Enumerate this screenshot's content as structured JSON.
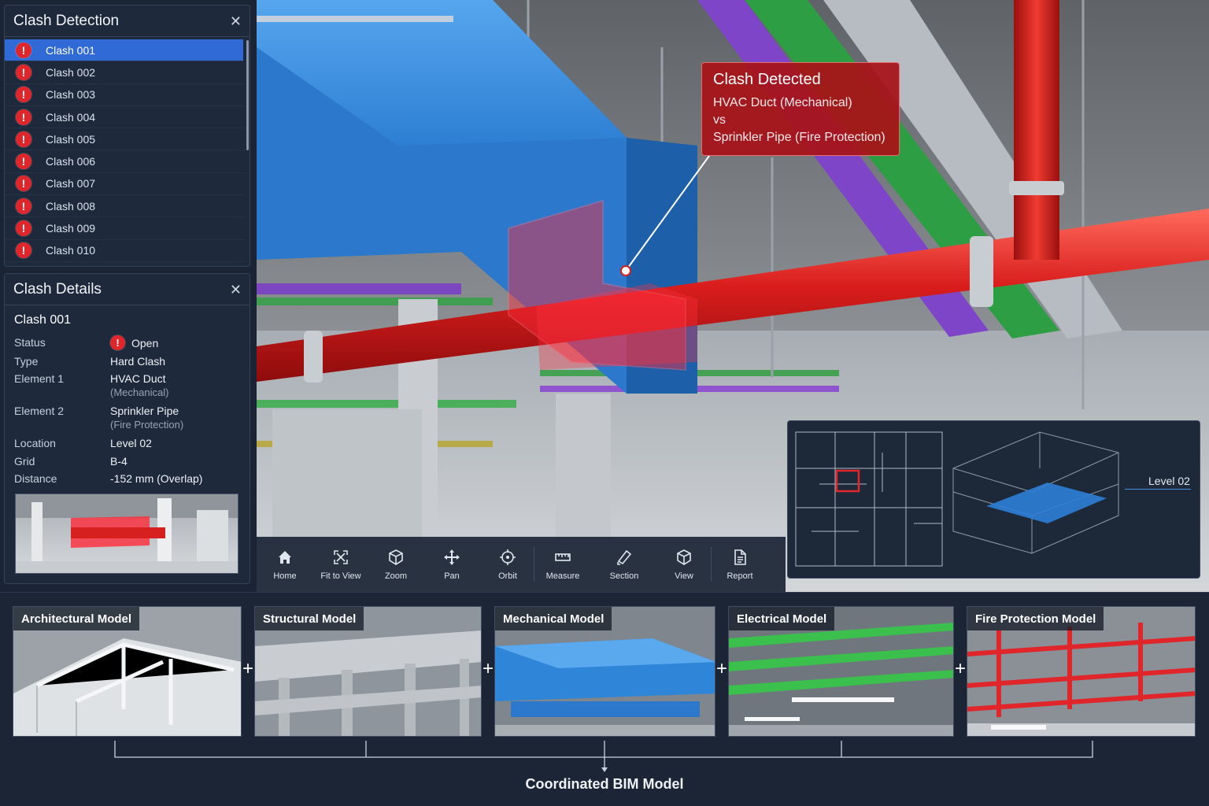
{
  "clash_panel": {
    "title": "Clash Detection",
    "items": [
      {
        "label": "Clash 001",
        "selected": true
      },
      {
        "label": "Clash 002"
      },
      {
        "label": "Clash 003"
      },
      {
        "label": "Clash 004"
      },
      {
        "label": "Clash 005"
      },
      {
        "label": "Clash 006"
      },
      {
        "label": "Clash 007"
      },
      {
        "label": "Clash 008"
      },
      {
        "label": "Clash 009"
      },
      {
        "label": "Clash 010"
      }
    ]
  },
  "details": {
    "title": "Clash Details",
    "name": "Clash 001",
    "status_label": "Status",
    "status_value": "Open",
    "type_label": "Type",
    "type_value": "Hard Clash",
    "el1_label": "Element 1",
    "el1_value": "HVAC Duct",
    "el1_sub": "(Mechanical)",
    "el2_label": "Element 2",
    "el2_value": "Sprinkler Pipe",
    "el2_sub": "(Fire Protection)",
    "location_label": "Location",
    "location_value": "Level 02",
    "grid_label": "Grid",
    "grid_value": "B-4",
    "distance_label": "Distance",
    "distance_value": "-152 mm (Overlap)"
  },
  "callout": {
    "title": "Clash Detected",
    "line1": "HVAC Duct (Mechanical)",
    "line2": "vs",
    "line3": "Sprinkler Pipe (Fire Protection)"
  },
  "toolbar": {
    "home": "Home",
    "fit": "Fit to View",
    "zoom": "Zoom",
    "pan": "Pan",
    "orbit": "Orbit",
    "measure": "Measure",
    "section": "Section",
    "view": "View",
    "report": "Report"
  },
  "minimap": {
    "level": "Level 02"
  },
  "models": {
    "architectural": "Architectural Model",
    "structural": "Structural Model",
    "mechanical": "Mechanical Model",
    "electrical": "Electrical Model",
    "fire": "Fire Protection Model",
    "plus": "+",
    "coordinated": "Coordinated BIM Model"
  },
  "colors": {
    "accent": "#2f6ad6",
    "clash_red": "#e0262b",
    "duct_blue": "#2f86d8",
    "pipe_red": "#d61f1f",
    "electrical_green": "#2ea84a",
    "data_purple": "#7a3fc4"
  }
}
